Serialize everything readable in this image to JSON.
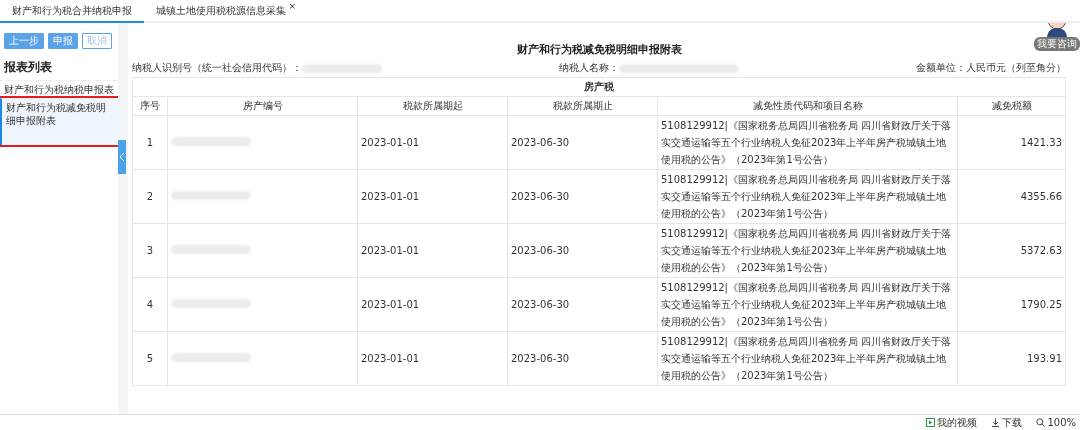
{
  "tabs": [
    {
      "label": "财产和行为税合并纳税申报",
      "selected": true
    },
    {
      "label": "城镇土地使用税税源信息采集",
      "selected": false,
      "close": "×"
    }
  ],
  "toolbar": {
    "buttons": [
      {
        "label": "上一步",
        "kind": "primary"
      },
      {
        "label": "申报",
        "kind": "primary"
      },
      {
        "label": "取消",
        "kind": "outline"
      }
    ]
  },
  "sidebar": {
    "title": "报表列表",
    "items": [
      {
        "label": "财产和行为税纳税申报表",
        "selected": false,
        "highlighted": false
      },
      {
        "label": "财产和行为税减免税明细申报附表",
        "selected": true,
        "highlighted": true
      }
    ]
  },
  "report": {
    "title": "财产和行为税减免税明细申报附表",
    "taxpayer_id_label": "纳税人识别号（统一社会信用代码）：",
    "taxpayer_name_label": "纳税人名称：",
    "unit": "金额单位：人民币元（列至角分）",
    "section": "房产税",
    "columns": [
      "序号",
      "房产编号",
      "税款所属期起",
      "税款所属期止",
      "减免性质代码和项目名称",
      "减免税额"
    ],
    "rows": [
      {
        "index": "1",
        "start": "2023-01-01",
        "end": "2023-06-30",
        "relief": "5108129912|《国家税务总局四川省税务局 四川省财政厅关于落实交通运输等五个行业纳税人免征2023年上半年房产税城镇土地使用税的公告》（2023年第1号公告）",
        "amount": "1421.33"
      },
      {
        "index": "2",
        "start": "2023-01-01",
        "end": "2023-06-30",
        "relief": "5108129912|《国家税务总局四川省税务局 四川省财政厅关于落实交通运输等五个行业纳税人免征2023年上半年房产税城镇土地使用税的公告》（2023年第1号公告）",
        "amount": "4355.66"
      },
      {
        "index": "3",
        "start": "2023-01-01",
        "end": "2023-06-30",
        "relief": "5108129912|《国家税务总局四川省税务局 四川省财政厅关于落实交通运输等五个行业纳税人免征2023年上半年房产税城镇土地使用税的公告》（2023年第1号公告）",
        "amount": "5372.63"
      },
      {
        "index": "4",
        "start": "2023-01-01",
        "end": "2023-06-30",
        "relief": "5108129912|《国家税务总局四川省税务局 四川省财政厅关于落实交通运输等五个行业纳税人免征2023年上半年房产税城镇土地使用税的公告》（2023年第1号公告）",
        "amount": "1790.25"
      },
      {
        "index": "5",
        "start": "2023-01-01",
        "end": "2023-06-30",
        "relief": "5108129912|《国家税务总局四川省税务局 四川省财政厅关于落实交通运输等五个行业纳税人免征2023年上半年房产税城镇土地使用税的公告》（2023年第1号公告）",
        "amount": "193.91"
      }
    ]
  },
  "assistant": {
    "label": "我要咨询"
  },
  "status_bar": {
    "items": [
      {
        "label": "我的视频",
        "kind": "video"
      },
      {
        "label": "下载",
        "kind": "download"
      },
      {
        "label": "100%",
        "kind": "zoom"
      }
    ]
  }
}
